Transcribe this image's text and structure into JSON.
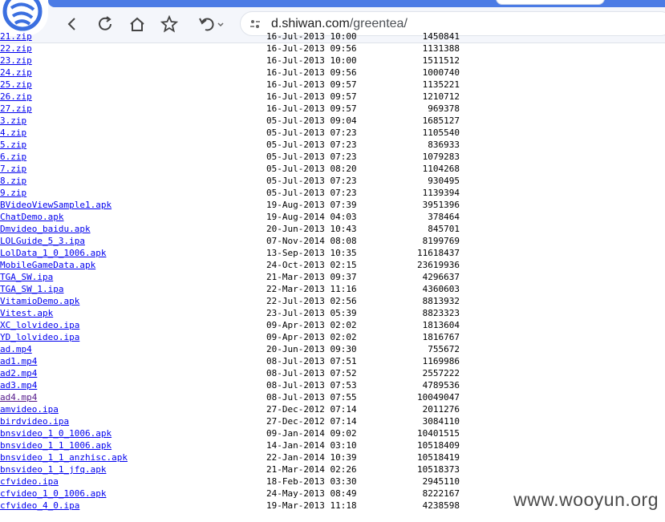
{
  "browser": {
    "url_host": "d.shiwan.com",
    "url_path": "/greentea/"
  },
  "files": [
    {
      "name": "21.zip",
      "date": "16-Jul-2013 10:00",
      "size": "1450841"
    },
    {
      "name": "22.zip",
      "date": "16-Jul-2013 09:56",
      "size": "1131388"
    },
    {
      "name": "23.zip",
      "date": "16-Jul-2013 10:00",
      "size": "1511512"
    },
    {
      "name": "24.zip",
      "date": "16-Jul-2013 09:56",
      "size": "1000740"
    },
    {
      "name": "25.zip",
      "date": "16-Jul-2013 09:57",
      "size": "1135221"
    },
    {
      "name": "26.zip",
      "date": "16-Jul-2013 09:57",
      "size": "1210712"
    },
    {
      "name": "27.zip",
      "date": "16-Jul-2013 09:57",
      "size": "969378"
    },
    {
      "name": "3.zip",
      "date": "05-Jul-2013 09:04",
      "size": "1685127"
    },
    {
      "name": "4.zip",
      "date": "05-Jul-2013 07:23",
      "size": "1105540"
    },
    {
      "name": "5.zip",
      "date": "05-Jul-2013 07:23",
      "size": "836933"
    },
    {
      "name": "6.zip",
      "date": "05-Jul-2013 07:23",
      "size": "1079283"
    },
    {
      "name": "7.zip",
      "date": "05-Jul-2013 08:20",
      "size": "1104268"
    },
    {
      "name": "8.zip",
      "date": "05-Jul-2013 07:23",
      "size": "930495"
    },
    {
      "name": "9.zip",
      "date": "05-Jul-2013 07:23",
      "size": "1139394"
    },
    {
      "name": "BVideoViewSample1.apk",
      "date": "19-Aug-2013 07:39",
      "size": "3951396"
    },
    {
      "name": "ChatDemo.apk",
      "date": "19-Aug-2014 04:03",
      "size": "378464"
    },
    {
      "name": "Dmvideo_baidu.apk",
      "date": "20-Jun-2013 10:43",
      "size": "845701"
    },
    {
      "name": "LOLGuide_5_3.ipa",
      "date": "07-Nov-2014 08:08",
      "size": "8199769"
    },
    {
      "name": "LolData_1_0_1006.apk",
      "date": "13-Sep-2013 10:35",
      "size": "11618437"
    },
    {
      "name": "MobileGameData.apk",
      "date": "24-Oct-2013 02:15",
      "size": "23619936"
    },
    {
      "name": "TGA_SW.ipa",
      "date": "21-Mar-2013 09:37",
      "size": "4296637"
    },
    {
      "name": "TGA_SW_1.ipa",
      "date": "22-Mar-2013 11:16",
      "size": "4360603"
    },
    {
      "name": "VitamioDemo.apk",
      "date": "22-Jul-2013 02:56",
      "size": "8813932"
    },
    {
      "name": "Vitest.apk",
      "date": "23-Jul-2013 05:39",
      "size": "8823323"
    },
    {
      "name": "XC_lolvideo.ipa",
      "date": "09-Apr-2013 02:02",
      "size": "1813604"
    },
    {
      "name": "YD_lolvideo.ipa",
      "date": "09-Apr-2013 02:02",
      "size": "1816767"
    },
    {
      "name": "ad.mp4",
      "date": "20-Jun-2013 09:30",
      "size": "755672"
    },
    {
      "name": "ad1.mp4",
      "date": "08-Jul-2013 07:51",
      "size": "1169986"
    },
    {
      "name": "ad2.mp4",
      "date": "08-Jul-2013 07:52",
      "size": "2557222"
    },
    {
      "name": "ad3.mp4",
      "date": "08-Jul-2013 07:53",
      "size": "4789536"
    },
    {
      "name": "ad4.mp4",
      "date": "08-Jul-2013 07:55",
      "size": "10049047",
      "visited": true
    },
    {
      "name": "amvideo.ipa",
      "date": "27-Dec-2012 07:14",
      "size": "2011276"
    },
    {
      "name": "birdvideo.ipa",
      "date": "27-Dec-2012 07:14",
      "size": "3084110"
    },
    {
      "name": "bnsvideo_1_0_1006.apk",
      "date": "09-Jan-2014 09:02",
      "size": "10401515"
    },
    {
      "name": "bnsvideo_1_1_1006.apk",
      "date": "14-Jan-2014 03:10",
      "size": "10518409"
    },
    {
      "name": "bnsvideo_1_1_anzhisc.apk",
      "date": "22-Jan-2014 10:39",
      "size": "10518419"
    },
    {
      "name": "bnsvideo_1_1_jfq.apk",
      "date": "21-Mar-2014 02:26",
      "size": "10518373"
    },
    {
      "name": "cfvideo.ipa",
      "date": "18-Feb-2013 03:30",
      "size": "2945110"
    },
    {
      "name": "cfvideo_1_0_1006.apk",
      "date": "24-May-2013 08:49",
      "size": "8222167"
    },
    {
      "name": "cfvideo_4_0.ipa",
      "date": "19-Mar-2013 11:18",
      "size": "4238598"
    }
  ],
  "watermark": "www.wooyun.org",
  "colors": {
    "link": "#0000ee",
    "visited": "#551a8b",
    "tab_accent": "#4b7be5"
  }
}
